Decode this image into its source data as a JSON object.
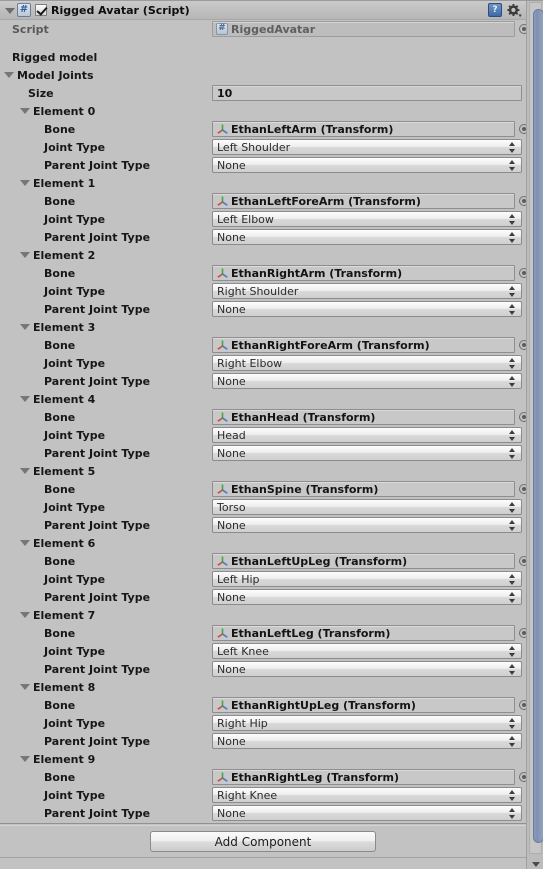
{
  "component": {
    "title": "Rigged Avatar (Script)",
    "enabled": true,
    "icon": "csharp-script-icon",
    "help_icon": "help-book-icon",
    "settings_icon": "gear-icon"
  },
  "script_row": {
    "label": "Script",
    "value": "RiggedAvatar"
  },
  "section": {
    "header": "Rigged model",
    "array_label": "Model Joints",
    "size_label": "Size",
    "size_value": "10"
  },
  "field_labels": {
    "bone": "Bone",
    "joint_type": "Joint Type",
    "parent_joint_type": "Parent Joint Type"
  },
  "elements": [
    {
      "label": "Element 0",
      "bone": "EthanLeftArm (Transform)",
      "joint_type": "Left Shoulder",
      "parent_joint_type": "None"
    },
    {
      "label": "Element 1",
      "bone": "EthanLeftForeArm (Transform)",
      "joint_type": "Left Elbow",
      "parent_joint_type": "None"
    },
    {
      "label": "Element 2",
      "bone": "EthanRightArm (Transform)",
      "joint_type": "Right Shoulder",
      "parent_joint_type": "None"
    },
    {
      "label": "Element 3",
      "bone": "EthanRightForeArm (Transform)",
      "joint_type": "Right Elbow",
      "parent_joint_type": "None"
    },
    {
      "label": "Element 4",
      "bone": "EthanHead (Transform)",
      "joint_type": "Head",
      "parent_joint_type": "None"
    },
    {
      "label": "Element 5",
      "bone": "EthanSpine (Transform)",
      "joint_type": "Torso",
      "parent_joint_type": "None"
    },
    {
      "label": "Element 6",
      "bone": "EthanLeftUpLeg (Transform)",
      "joint_type": "Left Hip",
      "parent_joint_type": "None"
    },
    {
      "label": "Element 7",
      "bone": "EthanLeftLeg (Transform)",
      "joint_type": "Left Knee",
      "parent_joint_type": "None"
    },
    {
      "label": "Element 8",
      "bone": "EthanRightUpLeg (Transform)",
      "joint_type": "Right Hip",
      "parent_joint_type": "None"
    },
    {
      "label": "Element 9",
      "bone": "EthanRightLeg (Transform)",
      "joint_type": "Right Knee",
      "parent_joint_type": "None"
    }
  ],
  "footer": {
    "add_component_label": "Add Component"
  },
  "colors": {
    "background": "#c2c2c2",
    "field_fill": "#c8c8c8",
    "scrollbar_thumb": "#8494b4",
    "script_icon_blue": "#3e6aa5"
  }
}
